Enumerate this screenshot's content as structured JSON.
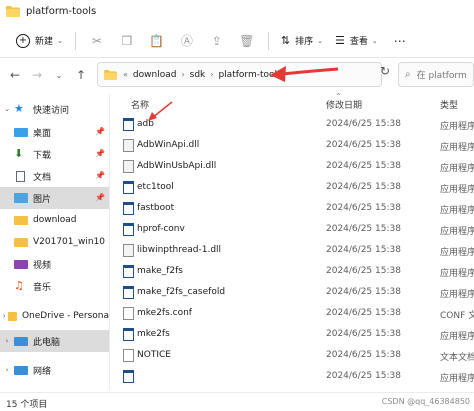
{
  "window": {
    "title": "platform-tools"
  },
  "toolbar": {
    "new_label": "新建",
    "sort_label": "排序",
    "view_label": "查看"
  },
  "address": {
    "crumbs": [
      "download",
      "sdk",
      "platform-tools"
    ],
    "search_placeholder": "在 platform"
  },
  "sidebar": {
    "items": [
      {
        "label": "快速访问"
      },
      {
        "label": "桌面"
      },
      {
        "label": "下载"
      },
      {
        "label": "文档"
      },
      {
        "label": "图片"
      },
      {
        "label": "download"
      },
      {
        "label": "V201701_win10"
      },
      {
        "label": "视频"
      },
      {
        "label": "音乐"
      },
      {
        "label": "OneDrive - Persona"
      },
      {
        "label": "此电脑"
      },
      {
        "label": "网络"
      }
    ]
  },
  "columns": {
    "name": "名称",
    "date": "修改日期",
    "type": "类型"
  },
  "files": [
    {
      "name": "adb",
      "date": "2024/6/25 15:38",
      "type": "应用程序",
      "icon": "exe-icon"
    },
    {
      "name": "AdbWinApi.dll",
      "date": "2024/6/25 15:38",
      "type": "应用程序",
      "icon": "dll-icon"
    },
    {
      "name": "AdbWinUsbApi.dll",
      "date": "2024/6/25 15:38",
      "type": "应用程序",
      "icon": "dll-icon"
    },
    {
      "name": "etc1tool",
      "date": "2024/6/25 15:38",
      "type": "应用程序",
      "icon": "exe-icon"
    },
    {
      "name": "fastboot",
      "date": "2024/6/25 15:38",
      "type": "应用程序",
      "icon": "exe-icon"
    },
    {
      "name": "hprof-conv",
      "date": "2024/6/25 15:38",
      "type": "应用程序",
      "icon": "exe-icon"
    },
    {
      "name": "libwinpthread-1.dll",
      "date": "2024/6/25 15:38",
      "type": "应用程序",
      "icon": "dll-icon"
    },
    {
      "name": "make_f2fs",
      "date": "2024/6/25 15:38",
      "type": "应用程序",
      "icon": "exe-icon"
    },
    {
      "name": "make_f2fs_casefold",
      "date": "2024/6/25 15:38",
      "type": "应用程序",
      "icon": "exe-icon"
    },
    {
      "name": "mke2fs.conf",
      "date": "2024/6/25 15:38",
      "type": "CONF 文件",
      "icon": "file-icon"
    },
    {
      "name": "mke2fs",
      "date": "2024/6/25 15:38",
      "type": "应用程序",
      "icon": "exe-icon"
    },
    {
      "name": "NOTICE",
      "date": "2024/6/25 15:38",
      "type": "文本文档",
      "icon": "file-icon"
    },
    {
      "name": "",
      "date": "2024/6/25 15:38",
      "type": "应用程序",
      "icon": "exe-icon"
    }
  ],
  "status": {
    "count": "15 个项目",
    "watermark": "CSDN @qq_46384850"
  },
  "colors": {
    "accent": "#0067c0",
    "annotation": "#e53935",
    "folder": "#f5c145"
  }
}
